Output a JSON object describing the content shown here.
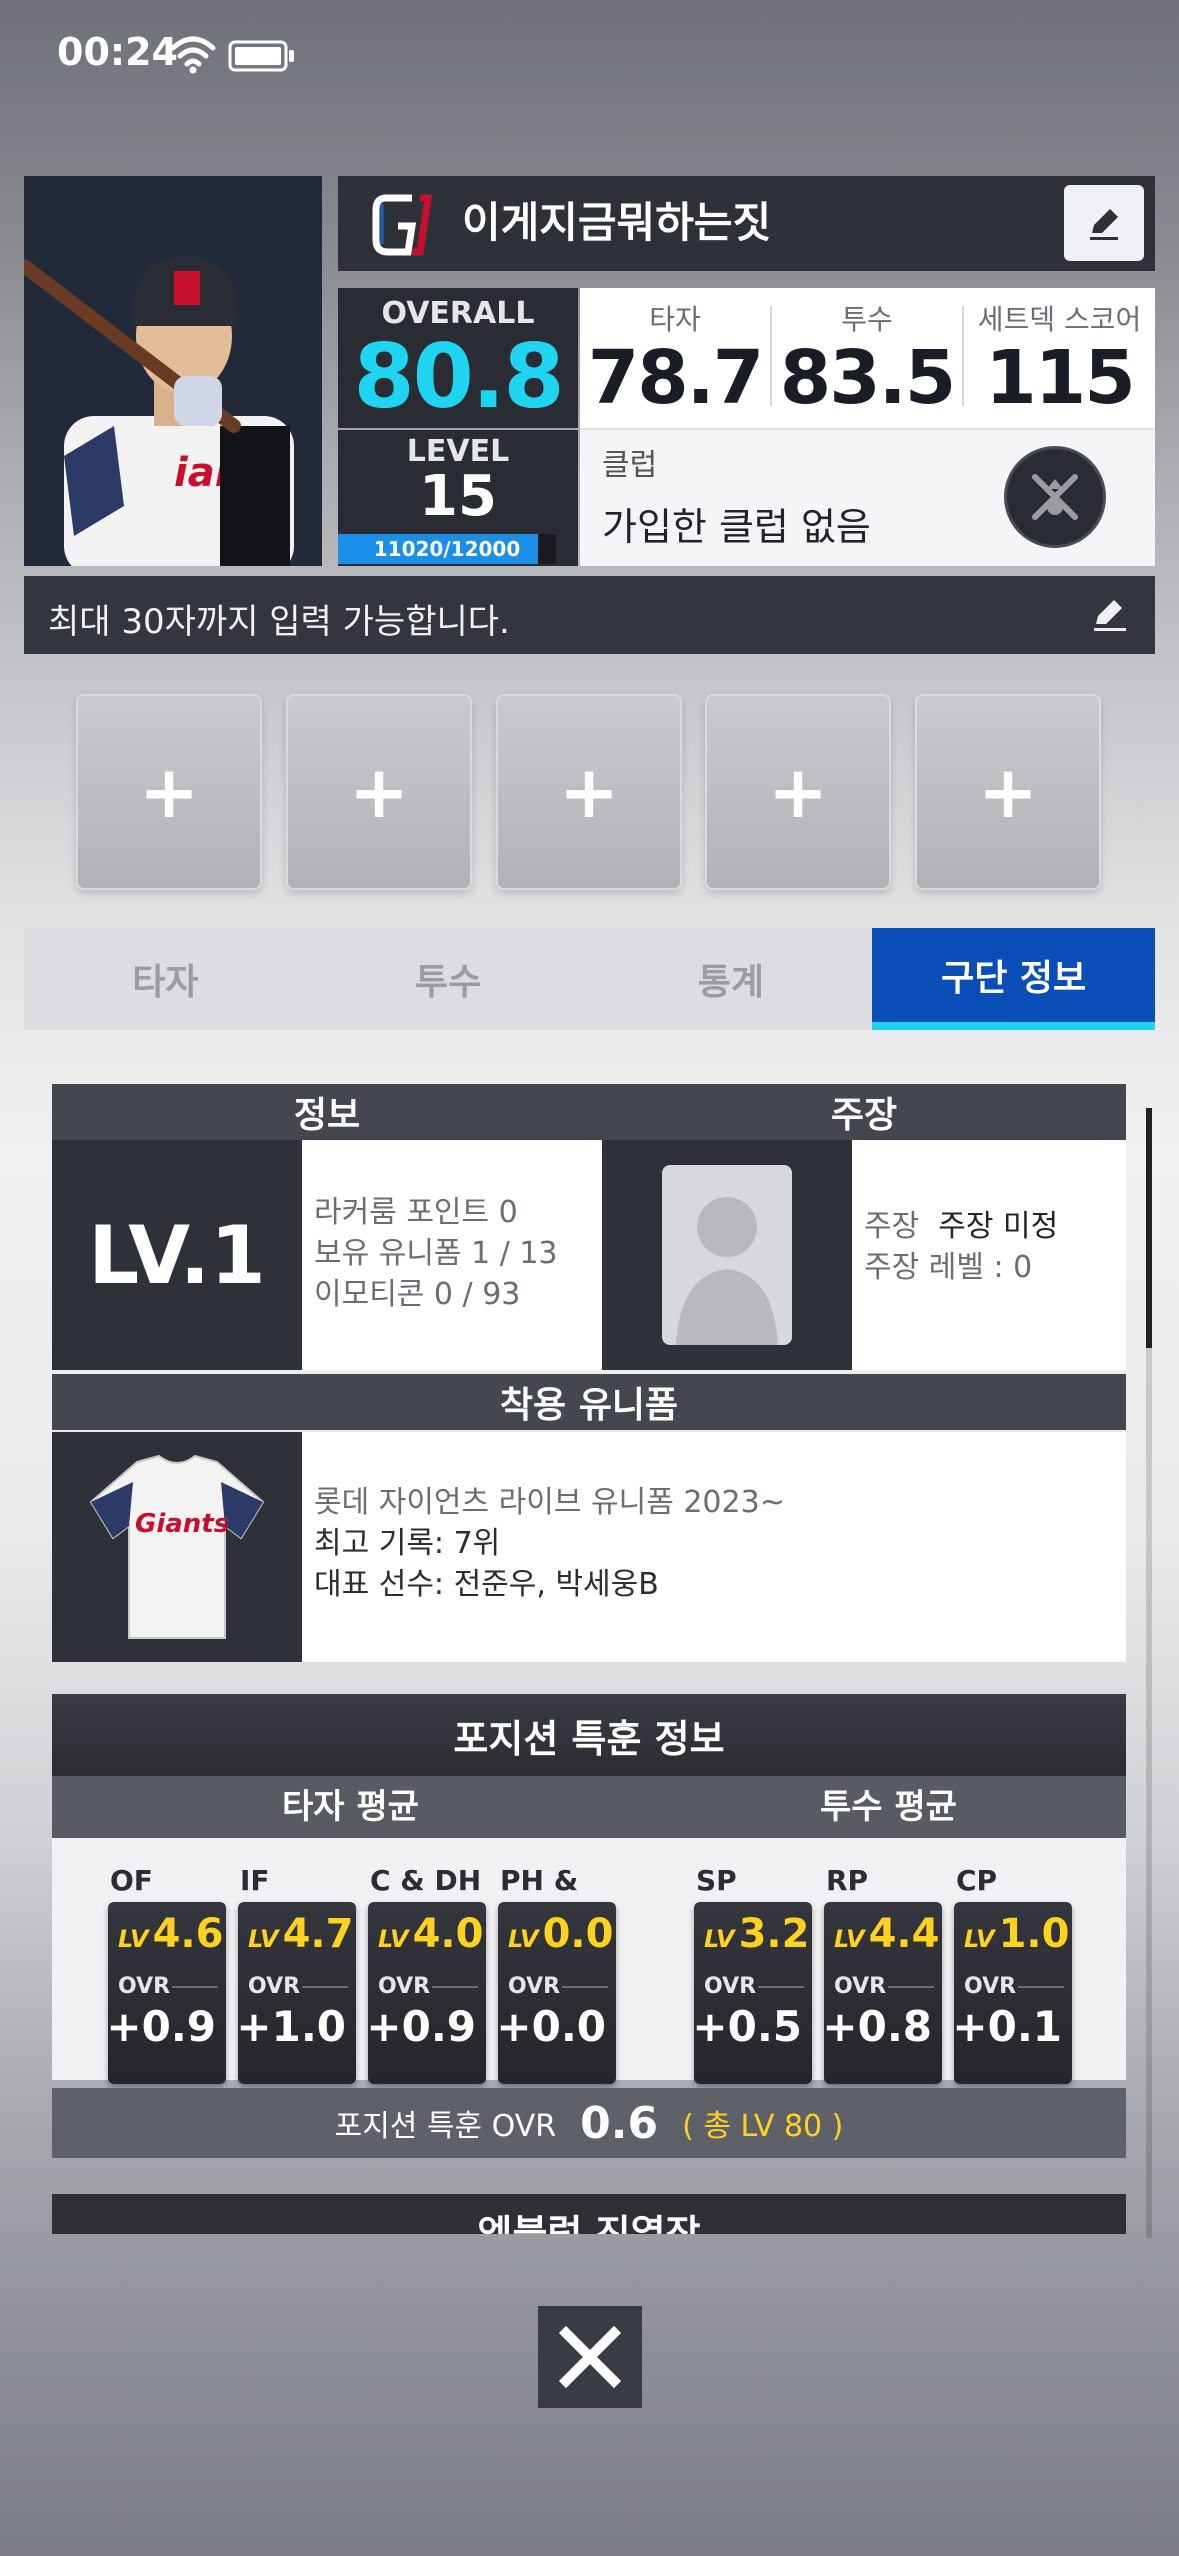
{
  "status_bar": {
    "time": "00:24"
  },
  "profile": {
    "nickname": "이게지금뭐하는짓",
    "overall_label": "OVERALL",
    "overall_value": "80.8",
    "level_label": "LEVEL",
    "level_value": "15",
    "exp_text": "11020/12000",
    "exp_fraction": 0.918,
    "stats": [
      {
        "label": "타자",
        "value": "78.7"
      },
      {
        "label": "투수",
        "value": "83.5"
      },
      {
        "label": "세트덱 스코어",
        "value": "115"
      }
    ],
    "club_label": "클럽",
    "club_value": "가입한 클럽 없음",
    "motto_placeholder": "최대 30자까지 입력 가능합니다."
  },
  "slots": [
    "+",
    "+",
    "+",
    "+",
    "+"
  ],
  "tabs": [
    {
      "label": "타자",
      "active": false
    },
    {
      "label": "투수",
      "active": false
    },
    {
      "label": "통계",
      "active": false
    },
    {
      "label": "구단 정보",
      "active": true
    }
  ],
  "team_info": {
    "info_header": "정보",
    "captain_header": "주장",
    "level": "LV.1",
    "lines": [
      "라커룸 포인트  0",
      "보유 유니폼 1 / 13",
      "이모티콘 0 / 93"
    ],
    "captain_label": "주장",
    "captain_value": "주장 미정",
    "captain_level": "주장 레벨 :  0",
    "uniform_header": "착용 유니폼",
    "uniform_name": "롯데 자이언츠 라이브 유니폼  2023~",
    "best_record": "최고 기록: 7위",
    "representative": "대표 선수: 전준우, 박세웅B"
  },
  "position_training": {
    "title": "포지션 특훈 정보",
    "batter_avg_label": "타자 평균",
    "pitcher_avg_label": "투수 평균",
    "lv_prefix": "LV",
    "ovr_label": "OVR",
    "cards": [
      {
        "pos": "OF",
        "lv": "4.6",
        "ovr": "+0.9"
      },
      {
        "pos": "IF",
        "lv": "4.7",
        "ovr": "+1.0"
      },
      {
        "pos": "C & DH",
        "lv": "4.0",
        "ovr": "+0.9"
      },
      {
        "pos": "PH & PR",
        "lv": "0.0",
        "ovr": "+0.0"
      },
      {
        "pos": "SP",
        "lv": "3.2",
        "ovr": "+0.5"
      },
      {
        "pos": "RP",
        "lv": "4.4",
        "ovr": "+0.8"
      },
      {
        "pos": "CP",
        "lv": "1.0",
        "ovr": "+0.1"
      }
    ],
    "footer_label": "포지션 특훈 OVR",
    "footer_value": "0.6",
    "footer_total": "( 총 LV 80 )"
  },
  "next_section_title": "엠블럼 진열장",
  "colors": {
    "accent_cyan": "#1fd4f0",
    "tab_active": "#0a4eb8",
    "gold": "#ffd21f"
  }
}
